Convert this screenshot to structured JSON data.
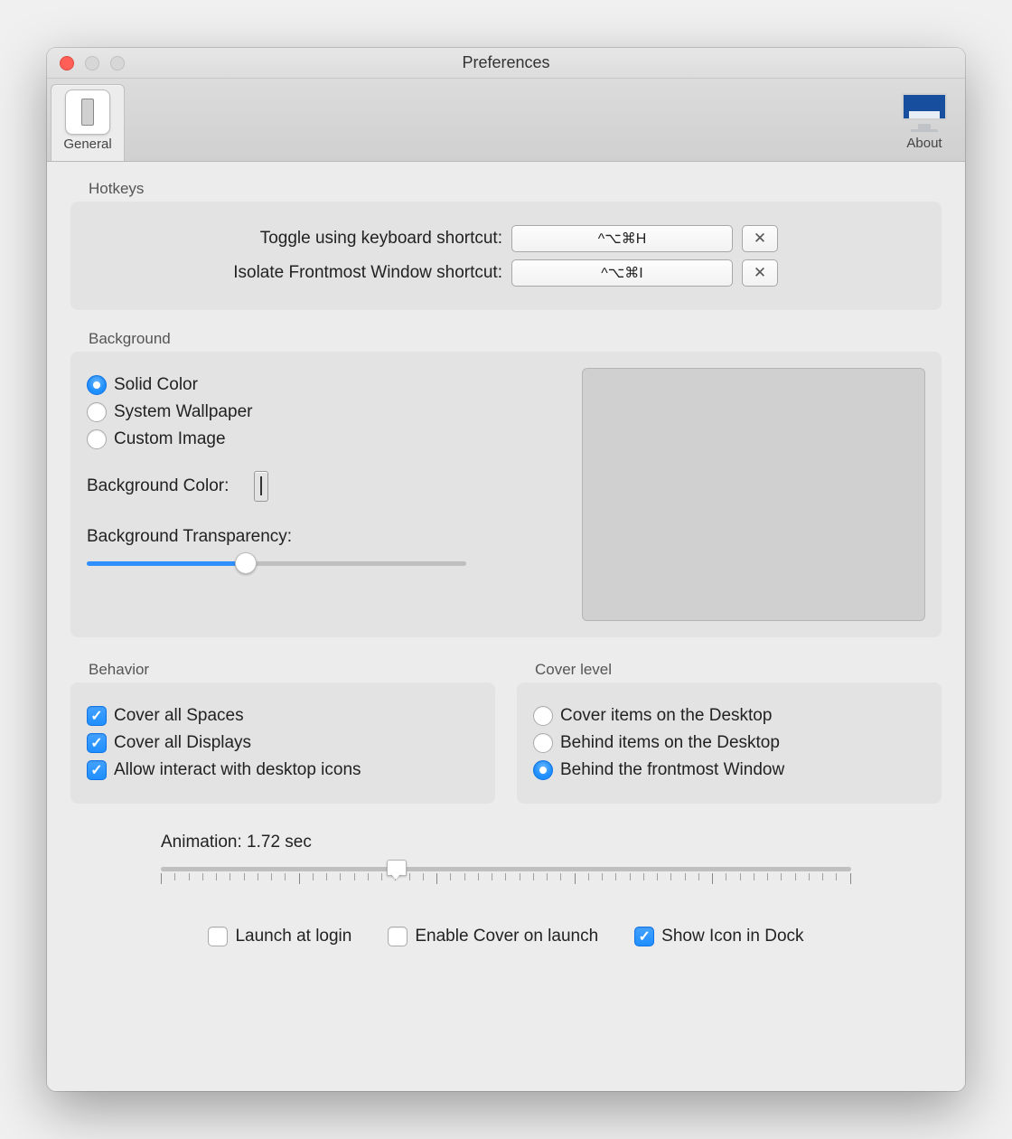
{
  "window": {
    "title": "Preferences"
  },
  "toolbar": {
    "general_label": "General",
    "about_label": "About"
  },
  "hotkeys": {
    "section": "Hotkeys",
    "toggle_label": "Toggle using keyboard shortcut:",
    "toggle_value": "^⌥⌘H",
    "isolate_label": "Isolate Frontmost Window shortcut:",
    "isolate_value": "^⌥⌘I"
  },
  "background": {
    "section": "Background",
    "options": {
      "solid": "Solid Color",
      "wallpaper": "System Wallpaper",
      "custom": "Custom Image"
    },
    "selected": "solid",
    "color_label": "Background Color:",
    "color_value": "#000000",
    "transparency_label": "Background Transparency:",
    "transparency_percent": 42
  },
  "behavior": {
    "section": "Behavior",
    "cover_spaces": "Cover all Spaces",
    "cover_displays": "Cover all Displays",
    "allow_interact": "Allow interact with desktop icons",
    "checked": {
      "cover_spaces": true,
      "cover_displays": true,
      "allow_interact": true
    }
  },
  "cover_level": {
    "section": "Cover level",
    "options": {
      "cover_items": "Cover items on the Desktop",
      "behind_items": "Behind items on the Desktop",
      "behind_front": "Behind the frontmost Window"
    },
    "selected": "behind_front"
  },
  "animation": {
    "label_prefix": "Animation: ",
    "value_text": "1.72 sec",
    "percent": 34
  },
  "footer": {
    "launch_login": "Launch at login",
    "enable_on_launch": "Enable Cover on launch",
    "show_dock": "Show Icon in Dock",
    "checked": {
      "launch_login": false,
      "enable_on_launch": false,
      "show_dock": true
    }
  }
}
